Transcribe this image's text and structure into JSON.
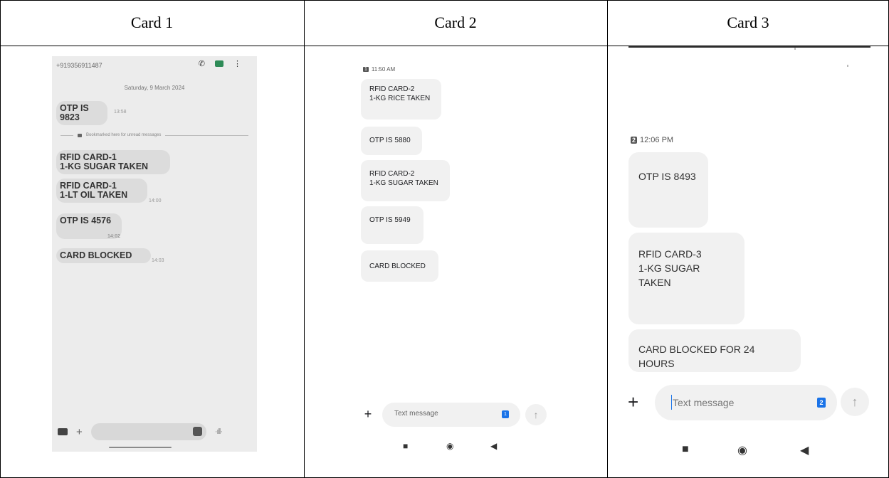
{
  "headers": [
    "Card 1",
    "Card 2",
    "Card 3"
  ],
  "card1": {
    "phone_number": "+919356911487",
    "date": "Saturday, 9 March 2024",
    "bookmark_text": "Bookmarked here for unread messages",
    "messages": [
      {
        "line1": "OTP IS 9823",
        "line2": "",
        "time": "13:58"
      },
      {
        "line1": "RFID CARD-1",
        "line2": "1-KG SUGAR TAKEN",
        "time": ""
      },
      {
        "line1": "RFID CARD-1",
        "line2": "1-LT OIL TAKEN",
        "time": "14:00"
      },
      {
        "line1": "OTP IS 4576",
        "line2": "",
        "time": "14:02"
      },
      {
        "line1": "CARD BLOCKED",
        "line2": "",
        "time": "14:03"
      }
    ]
  },
  "card2": {
    "sim_badge": "1",
    "timestamp": "11:50 AM",
    "messages": [
      {
        "line1": "RFID CARD-2",
        "line2": "1-KG RICE TAKEN"
      },
      {
        "line1": "OTP IS 5880",
        "line2": ""
      },
      {
        "line1": "RFID CARD-2",
        "line2": "1-KG SUGAR TAKEN"
      },
      {
        "line1": "OTP IS 5949",
        "line2": ""
      },
      {
        "line1": "CARD BLOCKED",
        "line2": ""
      }
    ],
    "input_placeholder": "Text message",
    "input_sim": "1",
    "nav": {
      "square": "■",
      "home": "◉",
      "back": "◀"
    }
  },
  "card3": {
    "sim_badge": "2",
    "timestamp": "12:06 PM",
    "messages": [
      {
        "line1": "OTP IS 8493",
        "line2": ""
      },
      {
        "line1": "RFID CARD-3",
        "line2": "1-KG SUGAR TAKEN"
      },
      {
        "line1": "CARD BLOCKED FOR 24 HOURS",
        "line2": ""
      }
    ],
    "input_placeholder": "Text message",
    "input_sim": "2",
    "nav": {
      "square": "■",
      "home": "◉",
      "back": "◀"
    }
  },
  "glyphs": {
    "plus": "+",
    "send_arrow": "↑",
    "wave": "·ıll·"
  }
}
